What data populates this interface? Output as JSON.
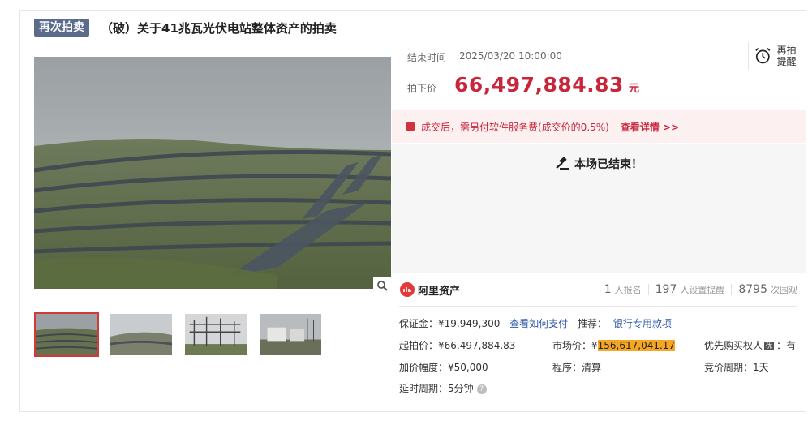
{
  "title": {
    "tag": "再次拍卖",
    "text": "（破）关于41兆瓦光伏电站整体资产的拍卖"
  },
  "auction": {
    "end_time_label": "结束时间",
    "end_time_value": "2025/03/20 10:00:00",
    "price_label": "拍下价",
    "price_value": "66,497,884.83",
    "price_unit": "元",
    "remind_label": "再拍提醒"
  },
  "notice": {
    "text": "成交后，需另付软件服务费(成交价的0.5%)",
    "link": "查看详情 >>"
  },
  "status": {
    "ended_text": "本场已结束！"
  },
  "brand": {
    "name": "阿里资产"
  },
  "stats": [
    {
      "num": "1",
      "label": "人报名"
    },
    {
      "num": "197",
      "label": "人设置提醒"
    },
    {
      "num": "8795",
      "label": "次围观"
    }
  ],
  "details": {
    "deposit": "保证金：¥19,949,300",
    "deposit_link": "查看如何支付",
    "recommend_label": "推荐：",
    "recommend_link": "银行专用款项",
    "start_price": "起拍价：¥66,497,884.83",
    "market_label": "市场价：¥",
    "market_value": "156,617,041.17",
    "priority_label": "优先购买权人",
    "priority_tag": "优",
    "priority_value": "：有",
    "increment": "加价幅度：¥50,000",
    "procedure": "程序：清算",
    "cycle": "竞价周期：1天",
    "delay": "延时周期：5分钟",
    "help_mark": "?"
  },
  "colors": {
    "price_red": "#c8263b",
    "tag_bg": "#5b6b8c",
    "link_blue": "#2f5aa8",
    "highlight": "#f5a623",
    "notice_bg": "#fdf0f0"
  },
  "icons": [
    "alarm-clock-icon",
    "gift-icon",
    "gavel-icon",
    "zoom-icon",
    "aliasset-logo-icon",
    "help-icon"
  ]
}
